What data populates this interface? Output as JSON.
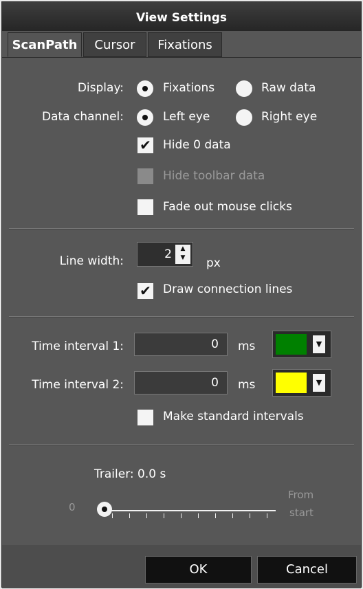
{
  "window": {
    "title": "View Settings"
  },
  "tabs": [
    "ScanPath",
    "Cursor",
    "Fixations"
  ],
  "display": {
    "label": "Display:",
    "options": [
      "Fixations",
      "Raw data"
    ],
    "selected": "Fixations"
  },
  "data_channel": {
    "label": "Data channel:",
    "options": [
      "Left eye",
      "Right eye"
    ],
    "selected": "Left eye"
  },
  "hide_zero": {
    "label": "Hide 0 data",
    "checked": true
  },
  "hide_toolbar": {
    "label": "Hide toolbar data",
    "checked": false,
    "enabled": false
  },
  "fade_clicks": {
    "label": "Fade out mouse clicks",
    "checked": false
  },
  "line_width": {
    "label": "Line width:",
    "value": "2",
    "unit": "px"
  },
  "draw_lines": {
    "label": "Draw connection lines",
    "checked": true
  },
  "time_interval_1": {
    "label": "Time interval 1:",
    "value": "0",
    "unit": "ms",
    "color": "#008000"
  },
  "time_interval_2": {
    "label": "Time interval 2:",
    "value": "0",
    "unit": "ms",
    "color": "#ffff00"
  },
  "standard_intervals": {
    "label": "Make standard intervals",
    "checked": false
  },
  "trailer": {
    "label": "Trailer: 0.0 s",
    "min_label": "0",
    "max_label_1": "From",
    "max_label_2": "start",
    "value": 0
  },
  "buttons": {
    "ok": "OK",
    "cancel": "Cancel"
  }
}
